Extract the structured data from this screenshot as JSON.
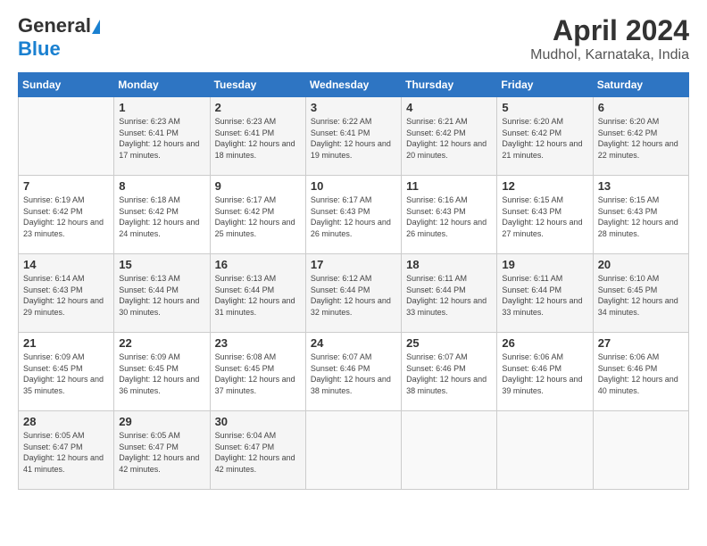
{
  "header": {
    "logo_general": "General",
    "logo_blue": "Blue",
    "title": "April 2024",
    "subtitle": "Mudhol, Karnataka, India"
  },
  "calendar": {
    "days_of_week": [
      "Sunday",
      "Monday",
      "Tuesday",
      "Wednesday",
      "Thursday",
      "Friday",
      "Saturday"
    ],
    "weeks": [
      [
        {
          "day": "",
          "sunrise": "",
          "sunset": "",
          "daylight": ""
        },
        {
          "day": "1",
          "sunrise": "Sunrise: 6:23 AM",
          "sunset": "Sunset: 6:41 PM",
          "daylight": "Daylight: 12 hours and 17 minutes."
        },
        {
          "day": "2",
          "sunrise": "Sunrise: 6:23 AM",
          "sunset": "Sunset: 6:41 PM",
          "daylight": "Daylight: 12 hours and 18 minutes."
        },
        {
          "day": "3",
          "sunrise": "Sunrise: 6:22 AM",
          "sunset": "Sunset: 6:41 PM",
          "daylight": "Daylight: 12 hours and 19 minutes."
        },
        {
          "day": "4",
          "sunrise": "Sunrise: 6:21 AM",
          "sunset": "Sunset: 6:42 PM",
          "daylight": "Daylight: 12 hours and 20 minutes."
        },
        {
          "day": "5",
          "sunrise": "Sunrise: 6:20 AM",
          "sunset": "Sunset: 6:42 PM",
          "daylight": "Daylight: 12 hours and 21 minutes."
        },
        {
          "day": "6",
          "sunrise": "Sunrise: 6:20 AM",
          "sunset": "Sunset: 6:42 PM",
          "daylight": "Daylight: 12 hours and 22 minutes."
        }
      ],
      [
        {
          "day": "7",
          "sunrise": "Sunrise: 6:19 AM",
          "sunset": "Sunset: 6:42 PM",
          "daylight": "Daylight: 12 hours and 23 minutes."
        },
        {
          "day": "8",
          "sunrise": "Sunrise: 6:18 AM",
          "sunset": "Sunset: 6:42 PM",
          "daylight": "Daylight: 12 hours and 24 minutes."
        },
        {
          "day": "9",
          "sunrise": "Sunrise: 6:17 AM",
          "sunset": "Sunset: 6:42 PM",
          "daylight": "Daylight: 12 hours and 25 minutes."
        },
        {
          "day": "10",
          "sunrise": "Sunrise: 6:17 AM",
          "sunset": "Sunset: 6:43 PM",
          "daylight": "Daylight: 12 hours and 26 minutes."
        },
        {
          "day": "11",
          "sunrise": "Sunrise: 6:16 AM",
          "sunset": "Sunset: 6:43 PM",
          "daylight": "Daylight: 12 hours and 26 minutes."
        },
        {
          "day": "12",
          "sunrise": "Sunrise: 6:15 AM",
          "sunset": "Sunset: 6:43 PM",
          "daylight": "Daylight: 12 hours and 27 minutes."
        },
        {
          "day": "13",
          "sunrise": "Sunrise: 6:15 AM",
          "sunset": "Sunset: 6:43 PM",
          "daylight": "Daylight: 12 hours and 28 minutes."
        }
      ],
      [
        {
          "day": "14",
          "sunrise": "Sunrise: 6:14 AM",
          "sunset": "Sunset: 6:43 PM",
          "daylight": "Daylight: 12 hours and 29 minutes."
        },
        {
          "day": "15",
          "sunrise": "Sunrise: 6:13 AM",
          "sunset": "Sunset: 6:44 PM",
          "daylight": "Daylight: 12 hours and 30 minutes."
        },
        {
          "day": "16",
          "sunrise": "Sunrise: 6:13 AM",
          "sunset": "Sunset: 6:44 PM",
          "daylight": "Daylight: 12 hours and 31 minutes."
        },
        {
          "day": "17",
          "sunrise": "Sunrise: 6:12 AM",
          "sunset": "Sunset: 6:44 PM",
          "daylight": "Daylight: 12 hours and 32 minutes."
        },
        {
          "day": "18",
          "sunrise": "Sunrise: 6:11 AM",
          "sunset": "Sunset: 6:44 PM",
          "daylight": "Daylight: 12 hours and 33 minutes."
        },
        {
          "day": "19",
          "sunrise": "Sunrise: 6:11 AM",
          "sunset": "Sunset: 6:44 PM",
          "daylight": "Daylight: 12 hours and 33 minutes."
        },
        {
          "day": "20",
          "sunrise": "Sunrise: 6:10 AM",
          "sunset": "Sunset: 6:45 PM",
          "daylight": "Daylight: 12 hours and 34 minutes."
        }
      ],
      [
        {
          "day": "21",
          "sunrise": "Sunrise: 6:09 AM",
          "sunset": "Sunset: 6:45 PM",
          "daylight": "Daylight: 12 hours and 35 minutes."
        },
        {
          "day": "22",
          "sunrise": "Sunrise: 6:09 AM",
          "sunset": "Sunset: 6:45 PM",
          "daylight": "Daylight: 12 hours and 36 minutes."
        },
        {
          "day": "23",
          "sunrise": "Sunrise: 6:08 AM",
          "sunset": "Sunset: 6:45 PM",
          "daylight": "Daylight: 12 hours and 37 minutes."
        },
        {
          "day": "24",
          "sunrise": "Sunrise: 6:07 AM",
          "sunset": "Sunset: 6:46 PM",
          "daylight": "Daylight: 12 hours and 38 minutes."
        },
        {
          "day": "25",
          "sunrise": "Sunrise: 6:07 AM",
          "sunset": "Sunset: 6:46 PM",
          "daylight": "Daylight: 12 hours and 38 minutes."
        },
        {
          "day": "26",
          "sunrise": "Sunrise: 6:06 AM",
          "sunset": "Sunset: 6:46 PM",
          "daylight": "Daylight: 12 hours and 39 minutes."
        },
        {
          "day": "27",
          "sunrise": "Sunrise: 6:06 AM",
          "sunset": "Sunset: 6:46 PM",
          "daylight": "Daylight: 12 hours and 40 minutes."
        }
      ],
      [
        {
          "day": "28",
          "sunrise": "Sunrise: 6:05 AM",
          "sunset": "Sunset: 6:47 PM",
          "daylight": "Daylight: 12 hours and 41 minutes."
        },
        {
          "day": "29",
          "sunrise": "Sunrise: 6:05 AM",
          "sunset": "Sunset: 6:47 PM",
          "daylight": "Daylight: 12 hours and 42 minutes."
        },
        {
          "day": "30",
          "sunrise": "Sunrise: 6:04 AM",
          "sunset": "Sunset: 6:47 PM",
          "daylight": "Daylight: 12 hours and 42 minutes."
        },
        {
          "day": "",
          "sunrise": "",
          "sunset": "",
          "daylight": ""
        },
        {
          "day": "",
          "sunrise": "",
          "sunset": "",
          "daylight": ""
        },
        {
          "day": "",
          "sunrise": "",
          "sunset": "",
          "daylight": ""
        },
        {
          "day": "",
          "sunrise": "",
          "sunset": "",
          "daylight": ""
        }
      ]
    ]
  }
}
